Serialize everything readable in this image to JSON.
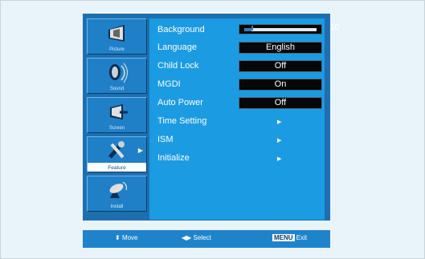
{
  "sidebar": {
    "items": [
      {
        "label": "Picture",
        "icon": "picture-icon",
        "active": false
      },
      {
        "label": "Sound",
        "icon": "sound-icon",
        "active": false
      },
      {
        "label": "Screen",
        "icon": "screen-icon",
        "active": false
      },
      {
        "label": "Feature",
        "icon": "feature-icon",
        "active": true
      },
      {
        "label": "Install",
        "icon": "install-icon",
        "active": false
      }
    ]
  },
  "menu": {
    "background": {
      "label": "Background",
      "value": 10,
      "min": 0,
      "max": 100
    },
    "rows": [
      {
        "label": "Language",
        "value": "English"
      },
      {
        "label": "Child Lock",
        "value": "Off"
      },
      {
        "label": "MGDI",
        "value": "On"
      },
      {
        "label": "Auto Power",
        "value": "Off"
      },
      {
        "label": "Time Setting",
        "value": ""
      },
      {
        "label": "ISM",
        "value": ""
      },
      {
        "label": "Initialize",
        "value": ""
      }
    ]
  },
  "footer": {
    "move": "Move",
    "select": "Select",
    "menu_key": "MENU",
    "exit": "Exit"
  },
  "colors": {
    "panel": "#1e6fb0",
    "menu": "#1b9be2",
    "value_box": "#070707"
  }
}
